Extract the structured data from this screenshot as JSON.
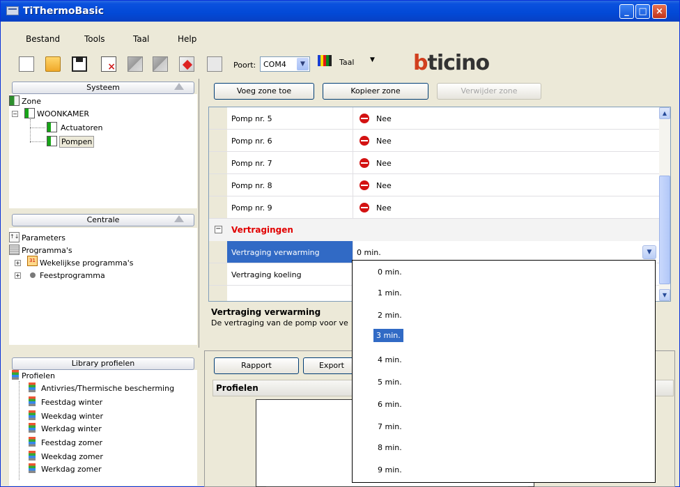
{
  "window": {
    "title": "TiThermoBasic"
  },
  "menu": [
    "Bestand",
    "Tools",
    "Taal",
    "Help"
  ],
  "toolbar": {
    "poort_label": "Poort:",
    "poort_value": "COM4",
    "taal_label": "Taal",
    "logo": "bticino"
  },
  "systeem": {
    "header": "Systeem",
    "items": [
      "Zone",
      "WOONKAMER",
      "Actuatoren",
      "Pompen"
    ]
  },
  "centrale": {
    "header": "Centrale",
    "items": [
      "Parameters",
      "Programma's",
      "Wekelijkse programma's",
      "Feestprogramma"
    ]
  },
  "library": {
    "header": "Library profielen",
    "root": "Profielen",
    "items": [
      "Antivries/Thermische bescherming",
      "Feestdag winter",
      "Weekdag winter",
      "Werkdag winter",
      "Feestdag zomer",
      "Weekdag zomer",
      "Werkdag zomer"
    ]
  },
  "zone_buttons": [
    "Voeg zone toe",
    "Kopieer zone",
    "Verwijder zone"
  ],
  "grid": {
    "rows": [
      {
        "name": "Pomp nr. 5",
        "value": "Nee"
      },
      {
        "name": "Pomp nr. 6",
        "value": "Nee"
      },
      {
        "name": "Pomp nr. 7",
        "value": "Nee"
      },
      {
        "name": "Pomp nr. 8",
        "value": "Nee"
      },
      {
        "name": "Pomp nr. 9",
        "value": "Nee"
      }
    ],
    "section": "Vertragingen",
    "selected_row": {
      "name": "Vertraging verwarming",
      "value": "0 min."
    },
    "next_row": {
      "name": "Vertraging koeling"
    }
  },
  "description": {
    "title": "Vertraging verwarming",
    "text": "De vertraging van de pomp voor ve"
  },
  "dropdown": {
    "options": [
      "0 min.",
      "1 min.",
      "2 min.",
      "3 min.",
      "4 min.",
      "5 min.",
      "6 min.",
      "7 min.",
      "8 min.",
      "9 min."
    ],
    "selected": "3 min."
  },
  "bottom": {
    "buttons": [
      "Rapport",
      "Export"
    ],
    "profielen_label": "Profielen"
  }
}
